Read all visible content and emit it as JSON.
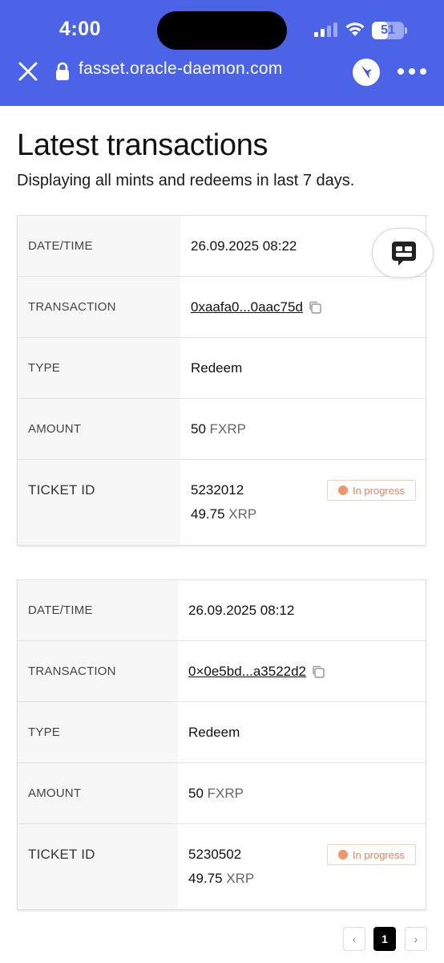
{
  "status_bar": {
    "time": "4:00",
    "battery": "51",
    "battery_level": 0.51
  },
  "browser": {
    "url": "fasset.oracle-daemon.com",
    "icons": [
      "close-icon",
      "lock-icon",
      "bird-icon",
      "more-icon"
    ]
  },
  "page": {
    "title": "Latest transactions",
    "subtitle": "Displaying all mints and redeems in last 7 days."
  },
  "labels": {
    "datetime": "DATE/TIME",
    "transaction": "TRANSACTION",
    "type": "TYPE",
    "amount": "AMOUNT",
    "ticket_id": "TICKET ID"
  },
  "transactions": [
    {
      "datetime": "26.09.2025 08:22",
      "tx_hash": "0xaafa0...0aac75d",
      "type": "Redeem",
      "amount": "50",
      "amount_unit": "FXRP",
      "ticket_id": "5232012",
      "ticket_amount": "49.75",
      "ticket_unit": "XRP",
      "status": "In progress"
    },
    {
      "datetime": "26.09.2025 08:12",
      "tx_hash": "0×0e5bd...a3522d2",
      "type": "Redeem",
      "amount": "50",
      "amount_unit": "FXRP",
      "ticket_id": "5230502",
      "ticket_amount": "49.75",
      "ticket_unit": "XRP",
      "status": "In progress"
    }
  ],
  "pagination": {
    "prev": "‹",
    "current": "1",
    "next": "›"
  },
  "colors": {
    "chrome": "#4a63e7",
    "status_in_progress": "#e8835a"
  }
}
